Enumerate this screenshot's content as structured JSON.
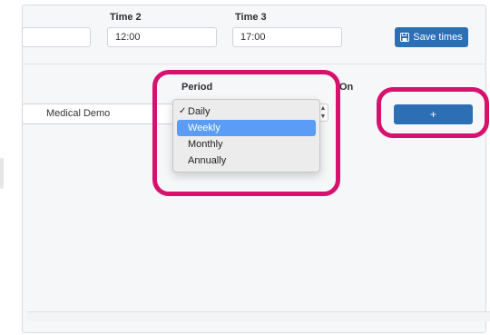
{
  "header": {
    "time2_label": "Time 2",
    "time3_label": "Time 3"
  },
  "fields": {
    "time1_value": "",
    "time2_value": "12:00",
    "time3_value": "17:00"
  },
  "toolbar": {
    "save_label": "Save times",
    "save_icon": "floppy-disk-icon"
  },
  "table": {
    "period_header": "Period",
    "on_header": "On",
    "row_name": "Medical Demo",
    "add_label": "+"
  },
  "period_dropdown": {
    "options": [
      "Daily",
      "Weekly",
      "Monthly",
      "Annually"
    ],
    "checked": "Daily",
    "hovered": "Weekly"
  },
  "colors": {
    "primary_button": "#2d6fb5",
    "highlight": "#d6116e",
    "selected_item": "#5b9cf7"
  }
}
